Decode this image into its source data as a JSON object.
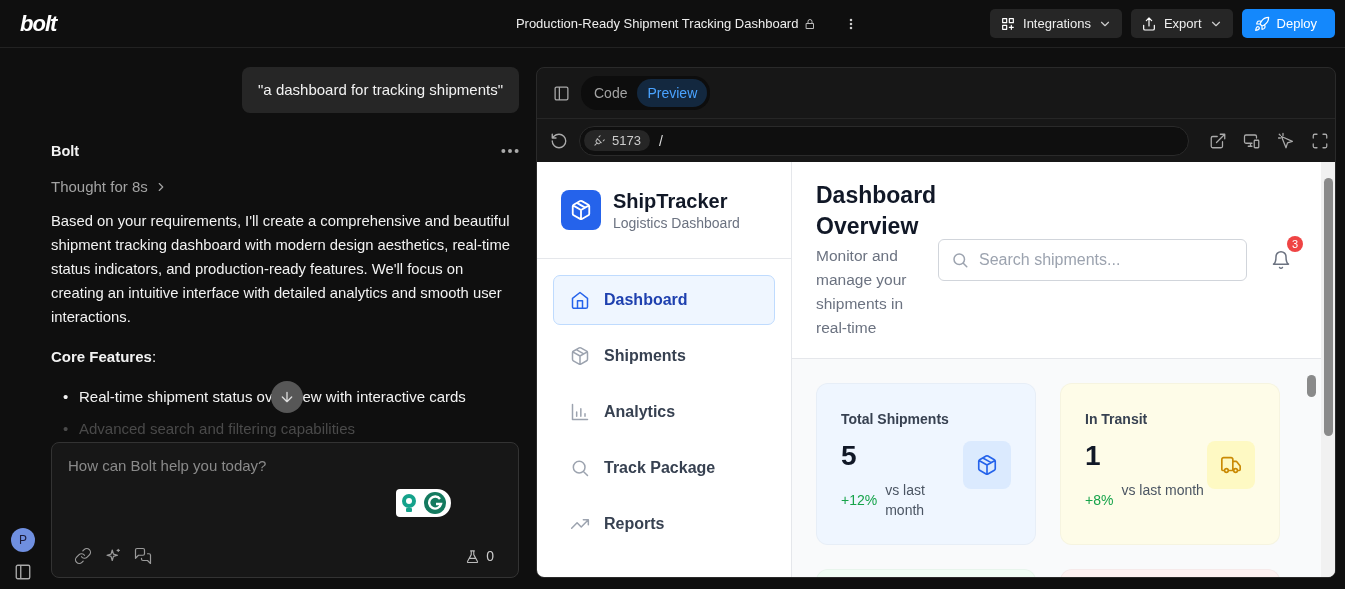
{
  "app_bar": {
    "logo": "bolt",
    "project_title": "Production-Ready Shipment Tracking Dashboard",
    "buttons": [
      {
        "label": "Integrations",
        "kind": "integrations"
      },
      {
        "label": "Export",
        "kind": "export"
      },
      {
        "label": "Deploy",
        "kind": "deploy"
      }
    ]
  },
  "user": {
    "initial": "P"
  },
  "chat": {
    "user_message": "\"a dashboard for tracking shipments\"",
    "assistant_name": "Bolt",
    "thought": "Thought for 8s",
    "paragraph": "Based on your requirements, I'll create a comprehensive and beautiful shipment tracking dashboard with modern design aesthetics, real-time status indicators, and production-ready features. We'll focus on creating an intuitive interface with detailed analytics and smooth user interactions.",
    "heading": "**Core Features**:",
    "bullets": [
      {
        "marker": "•",
        "text": "Real-time shipment status ov",
        "text_after": "ew with interactive cards",
        "faded": false
      },
      {
        "marker": "•",
        "text": "Advanced search and filtering capabilities",
        "faded": true
      }
    ],
    "input": {
      "placeholder": "How can Bolt help you today?"
    },
    "counter": "0"
  },
  "preview": {
    "tabs": [
      {
        "label": "Code",
        "selected": false
      },
      {
        "label": "Preview",
        "selected": true
      }
    ],
    "port": "5173",
    "path": "/",
    "app": {
      "brand": "ShipTracker",
      "brand_subtitle": "Logistics Dashboard",
      "nav": [
        {
          "label": "Dashboard",
          "kind": "home",
          "selected": true
        },
        {
          "label": "Shipments",
          "kind": "box",
          "selected": false
        },
        {
          "label": "Analytics",
          "kind": "chart",
          "selected": false
        },
        {
          "label": "Track Package",
          "kind": "search",
          "selected": false
        },
        {
          "label": "Reports",
          "kind": "trend",
          "selected": false
        }
      ],
      "title": "Dashboard Overview",
      "description": "Monitor and manage your shipments in real-time",
      "search": {
        "placeholder": "Search shipments..."
      },
      "notification_count": "3",
      "stats": [
        {
          "label": "Total Shipments",
          "value": "5",
          "change": "+12%",
          "change_note": "vs last month",
          "kind": "box",
          "color": "#eff6ff"
        },
        {
          "label": "In Transit",
          "value": "1",
          "change": "+8%",
          "change_note": "vs last month",
          "kind": "truck",
          "color": "#fefce8"
        }
      ],
      "more_cards": [
        {
          "color": "#f0fdf4"
        },
        {
          "color": "#fef2f2"
        }
      ]
    }
  }
}
